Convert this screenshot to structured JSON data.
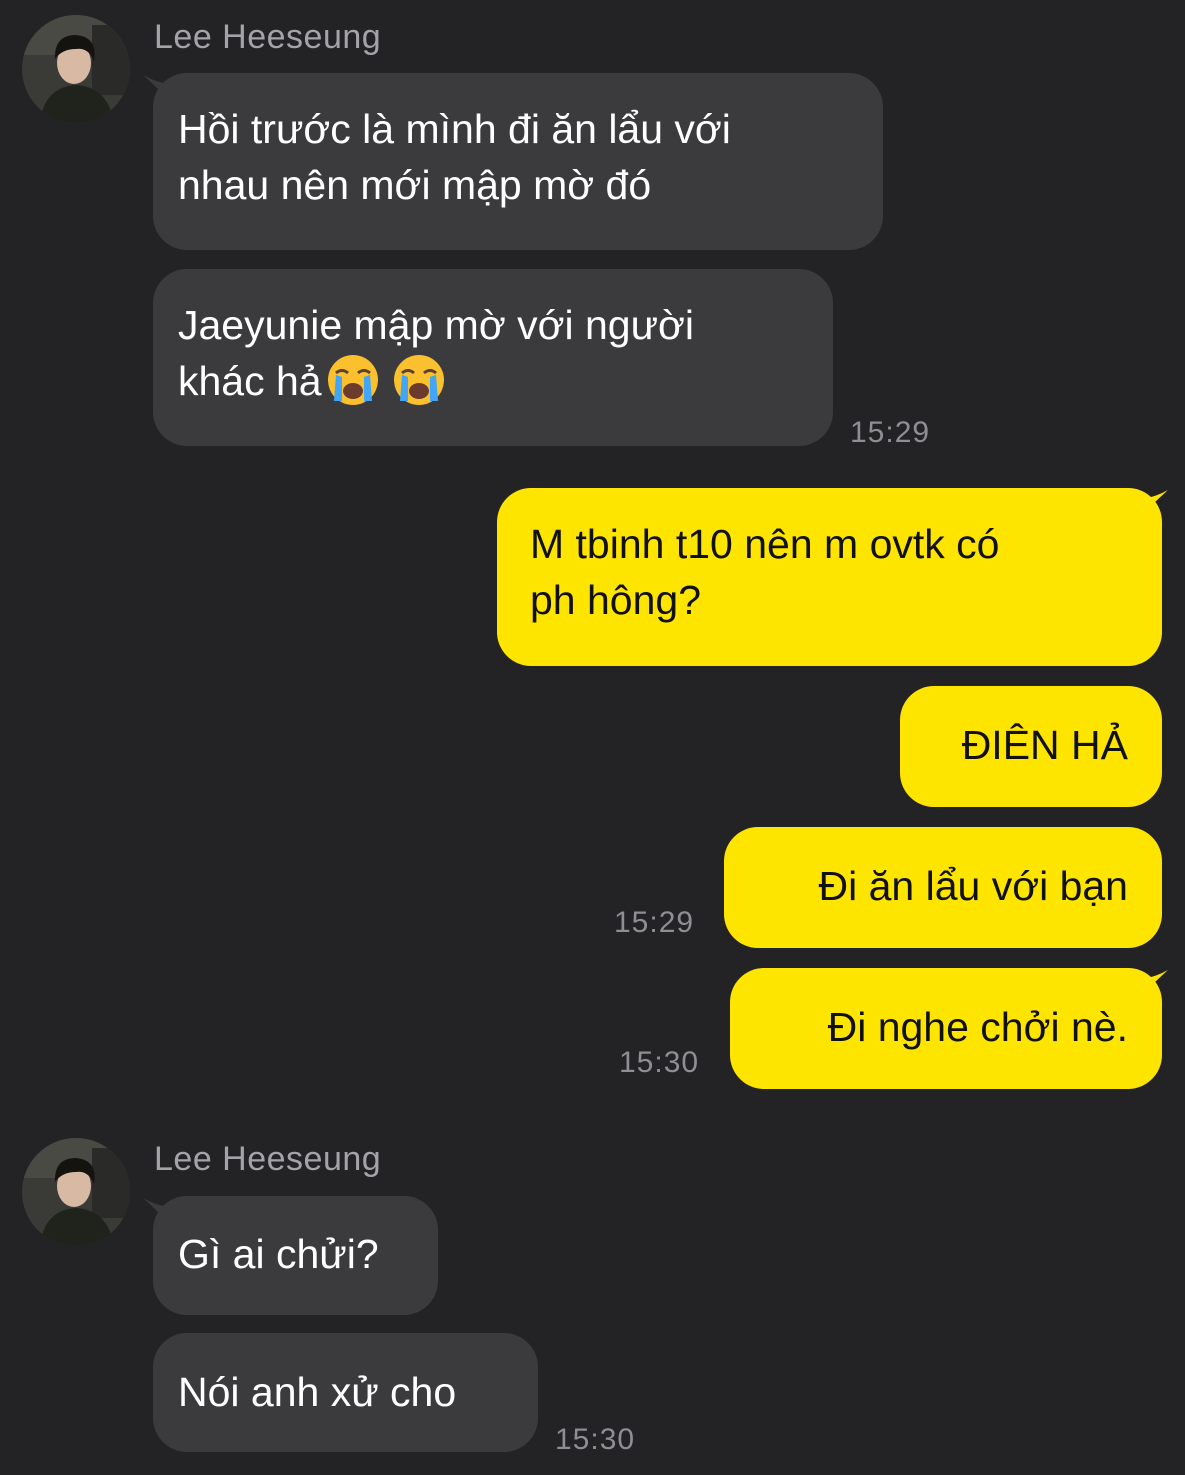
{
  "group1": {
    "sender": "Lee Heeseung",
    "msg1_line1": "Hồi trước là mình đi ăn lẩu với",
    "msg1_line2": "nhau nên mới mập mờ đó",
    "msg2_line1": "Jaeyunie mập mờ với người",
    "msg2_line2": "khác hả",
    "time": "15:29"
  },
  "outgoing": {
    "msg1_line1": "M tbinh t10 nên m ovtk có",
    "msg1_line2": "ph hông?",
    "msg2": "ĐIÊN HẢ",
    "msg3": "Đi ăn lẩu với bạn",
    "time1": "15:29",
    "msg4": "Đi nghe chởi nè.",
    "time2": "15:30"
  },
  "group2": {
    "sender": "Lee Heeseung",
    "msg1": "Gì ai chửi?",
    "msg2": "Nói anh xử cho",
    "time": "15:30"
  },
  "icons": {
    "avatar": "user-avatar-photo",
    "emoji": "loudly-crying-face-emoji"
  },
  "colors": {
    "background": "#232325",
    "incoming_bubble": "#3b3b3e",
    "outgoing_bubble": "#fee500",
    "timestamp": "#8e8e93",
    "sender_name": "#a3a3a8"
  }
}
